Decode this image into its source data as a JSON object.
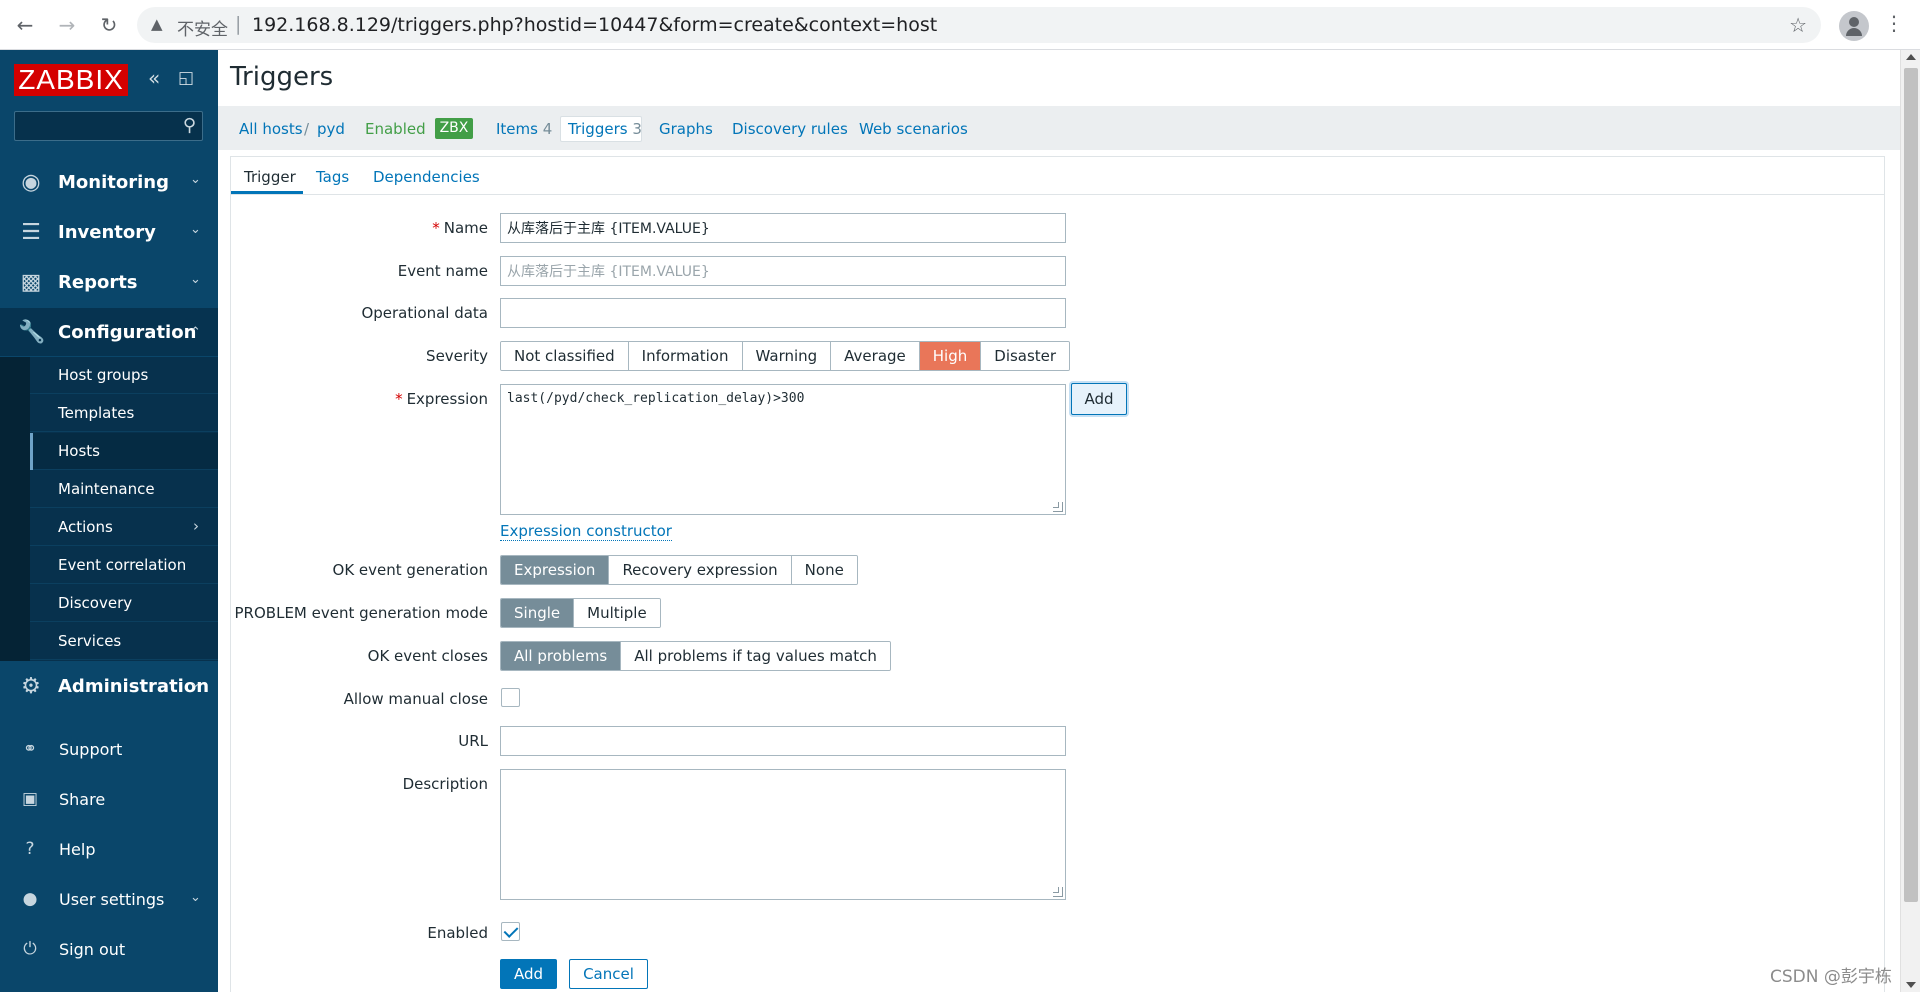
{
  "browser": {
    "insecure_label": "不安全",
    "separator": "|",
    "url": "192.168.8.129/triggers.php?hostid=10447&form=create&context=host"
  },
  "sidebar": {
    "logo": "ZABBIX",
    "menu": [
      {
        "label": "Monitoring",
        "icon": "eye-icon"
      },
      {
        "label": "Inventory",
        "icon": "list-icon"
      },
      {
        "label": "Reports",
        "icon": "chart-icon"
      },
      {
        "label": "Configuration",
        "icon": "wrench-icon"
      },
      {
        "label": "Administration",
        "icon": "gear-icon"
      }
    ],
    "submenu": [
      {
        "label": "Host groups"
      },
      {
        "label": "Templates"
      },
      {
        "label": "Hosts"
      },
      {
        "label": "Maintenance"
      },
      {
        "label": "Actions"
      },
      {
        "label": "Event correlation"
      },
      {
        "label": "Discovery"
      },
      {
        "label": "Services"
      }
    ],
    "bottom": [
      {
        "label": "Support",
        "icon": "headset-icon"
      },
      {
        "label": "Share",
        "icon": "share-z-icon"
      },
      {
        "label": "Help",
        "icon": "question-icon"
      },
      {
        "label": "User settings",
        "icon": "user-icon"
      },
      {
        "label": "Sign out",
        "icon": "power-icon"
      }
    ]
  },
  "page": {
    "title": "Triggers"
  },
  "host_nav": {
    "all_hosts": "All hosts",
    "slash": "/",
    "host": "pyd",
    "status": "Enabled",
    "badge": "ZBX",
    "items_label": "Items",
    "items_count": "4",
    "triggers_label": "Triggers",
    "triggers_count": "3",
    "graphs": "Graphs",
    "discovery": "Discovery rules",
    "web": "Web scenarios"
  },
  "form_tabs": [
    "Trigger",
    "Tags",
    "Dependencies"
  ],
  "form": {
    "required_mark": "*",
    "name_label": "Name",
    "name_value": "从库落后于主库 {ITEM.VALUE}",
    "event_name_label": "Event name",
    "event_name_placeholder": "从库落后于主库 {ITEM.VALUE}",
    "opdata_label": "Operational data",
    "severity_label": "Severity",
    "severity_options": [
      "Not classified",
      "Information",
      "Warning",
      "Average",
      "High",
      "Disaster"
    ],
    "severity_selected": "High",
    "expression_label": "Expression",
    "expression_value": "last(/pyd/check_replication_delay)>300",
    "expression_add": "Add",
    "expression_constructor": "Expression constructor",
    "ok_gen_label": "OK event generation",
    "ok_gen_options": [
      "Expression",
      "Recovery expression",
      "None"
    ],
    "problem_mode_label": "PROBLEM event generation mode",
    "problem_mode_options": [
      "Single",
      "Multiple"
    ],
    "ok_closes_label": "OK event closes",
    "ok_closes_options": [
      "All problems",
      "All problems if tag values match"
    ],
    "manual_close_label": "Allow manual close",
    "url_label": "URL",
    "description_label": "Description",
    "enabled_label": "Enabled",
    "add_button": "Add",
    "cancel_button": "Cancel"
  },
  "watermark": "CSDN @彭宇栋",
  "colors": {
    "sidebar": "#0a466a",
    "logo": "#d40000",
    "link": "#0275b8",
    "severity_high": "#e97659",
    "enabled_green": "#429e47"
  }
}
